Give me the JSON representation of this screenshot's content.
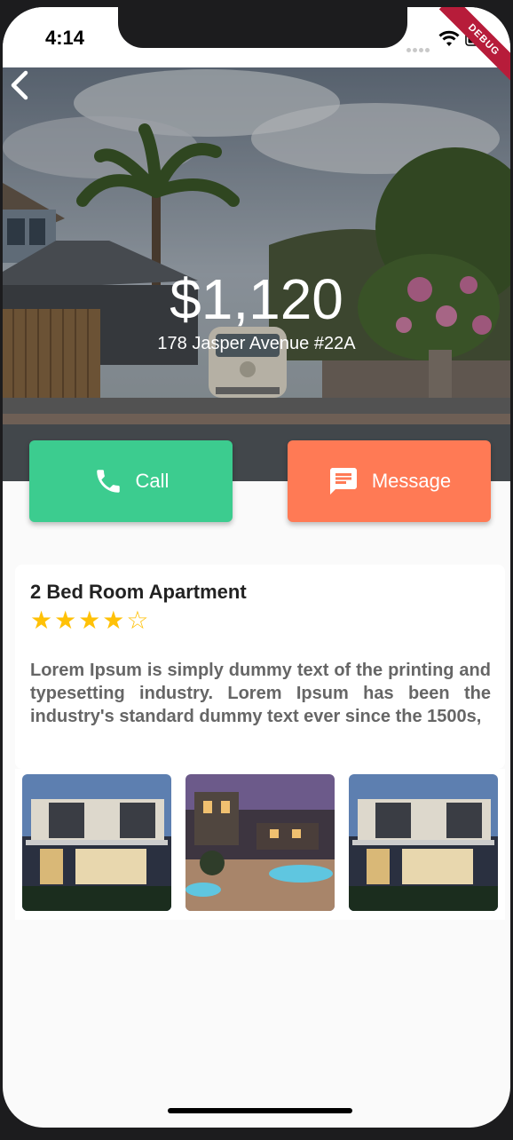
{
  "status_bar": {
    "time": "4:14",
    "debug_label": "DEBUG"
  },
  "listing": {
    "price": "$1,120",
    "address": "178 Jasper Avenue #22A",
    "title": "2 Bed Room Apartment",
    "rating": 4,
    "max_rating": 5,
    "stars_display": "★★★★☆",
    "description": "Lorem Ipsum is simply dummy text of the printing and typesetting industry. Lorem Ipsum has been the industry's standard dummy text ever since the 1500s,"
  },
  "actions": {
    "call_label": "Call",
    "message_label": "Message"
  },
  "icons": {
    "back": "back-arrow-icon",
    "call": "phone-icon",
    "message": "chat-bubble-icon"
  },
  "colors": {
    "call_button": "#3ccc8f",
    "message_button": "#ff7a55",
    "star": "#ffc107",
    "debug_banner": "#b71c3a"
  },
  "gallery": {
    "images": [
      "modern-house-photo",
      "villa-pool-photo",
      "modern-house-photo"
    ]
  }
}
